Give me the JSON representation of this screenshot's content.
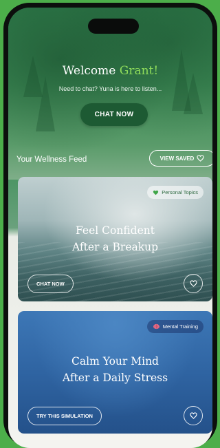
{
  "header": {
    "welcome_prefix": "Welcome",
    "user_name": "Grant!",
    "subtitle": "Need to chat? Yuna is here to listen...",
    "chat_button": "CHAT NOW"
  },
  "feed": {
    "title": "Your Wellness Feed",
    "view_saved_button": "VIEW SAVED",
    "cards": [
      {
        "tag": "Personal Topics",
        "tag_icon": "green-heart-icon",
        "title_line1": "Feel Confident",
        "title_line2": "After a Breakup",
        "action": "CHAT NOW",
        "favorite_icon": "heart-outline-icon"
      },
      {
        "tag": "Mental Training",
        "tag_icon": "brain-icon",
        "title_line1": "Calm Your Mind",
        "title_line2": "After a Daily Stress",
        "action": "TRY THIS SIMULATION",
        "favorite_icon": "heart-outline-icon"
      }
    ]
  },
  "colors": {
    "background": "#4cae4a",
    "accent_name": "#8fdc5a",
    "chat_button": "#1d5a33",
    "card2": "#2f64a2"
  }
}
